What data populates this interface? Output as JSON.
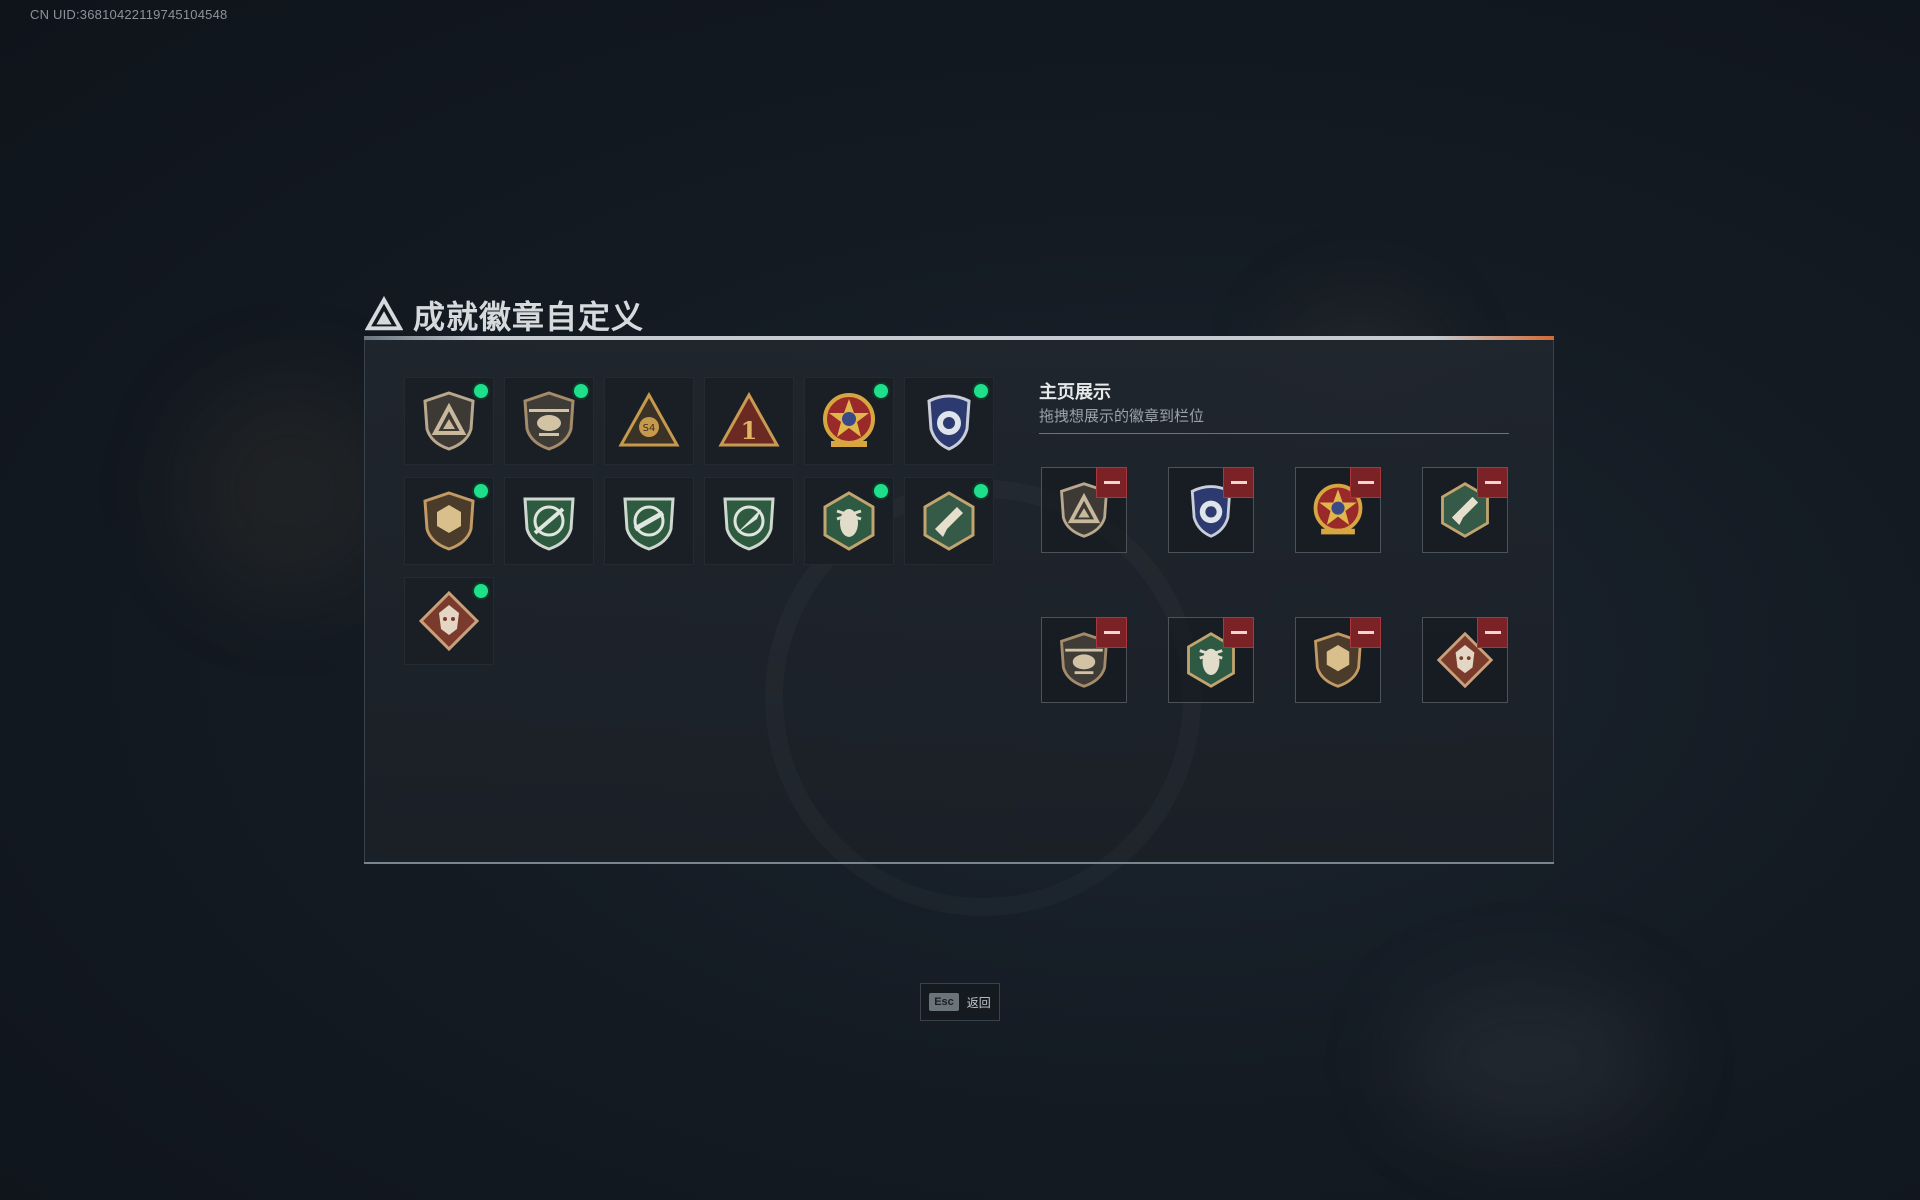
{
  "uid": "CN UID:36810422119745104548",
  "title": "成就徽章自定义",
  "badges": [
    {
      "icon": "delta-shield-badge-icon",
      "active": true
    },
    {
      "icon": "helicopter-badge-icon",
      "active": true
    },
    {
      "icon": "s4-triangle-badge-icon",
      "active": false
    },
    {
      "icon": "rank-one-triangle-badge-icon",
      "active": false
    },
    {
      "icon": "star-skull-medal-badge-icon",
      "active": true
    },
    {
      "icon": "blue-police-badge-icon",
      "active": true
    },
    {
      "icon": "bronze-hex-shield-badge-icon",
      "active": true
    },
    {
      "icon": "green-crosshair-sniper-badge-icon",
      "active": false
    },
    {
      "icon": "green-crosshair-rifle-badge-icon",
      "active": false
    },
    {
      "icon": "green-crosshair-knife-badge-icon",
      "active": false
    },
    {
      "icon": "green-hex-wasp-badge-icon",
      "active": true
    },
    {
      "icon": "green-hex-gun-badge-icon",
      "active": true
    },
    {
      "icon": "red-dragon-badge-icon",
      "active": true
    }
  ],
  "showcase": {
    "title": "主页展示",
    "subtitle": "拖拽想展示的徽章到栏位",
    "slots": [
      "delta-shield-badge-icon",
      "blue-police-badge-icon",
      "star-skull-medal-badge-icon",
      "green-hex-gun-badge-icon",
      "helicopter-badge-icon",
      "green-hex-wasp-badge-icon",
      "bronze-hex-shield-badge-icon",
      "red-dragon-badge-icon"
    ]
  },
  "footer": {
    "key": "Esc",
    "label": "返回"
  }
}
